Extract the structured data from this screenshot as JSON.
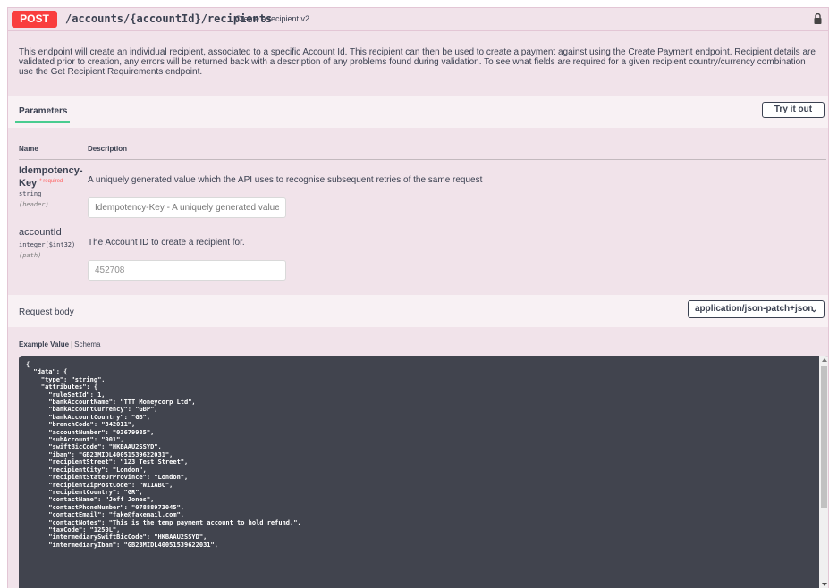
{
  "operation": {
    "method": "POST",
    "path": "/accounts/{accountId}/recipients",
    "summary": "Create a recipient v2",
    "method_color": "#f93e3e"
  },
  "description": "This endpoint will create an individual recipient, associated to a specific Account Id. This recipient can then be used to create a payment against using the Create Payment endpoint. Recipient details are validated prior to creation, any errors will be returned back with a description of any problems found during validation. To see what fields are required for a given recipient country/currency combination use the Get Recipient Requirements endpoint.",
  "parameters": {
    "title": "Parameters",
    "try_label": "Try it out",
    "col_name": "Name",
    "col_description": "Description",
    "items": [
      {
        "name_line1": "Idempotency-",
        "name_line2": "Key",
        "required_marker": "* required",
        "type": "string",
        "in": "(header)",
        "description": "A uniquely generated value which the API uses to recognise subsequent retries of the same request",
        "placeholder": "Idempotency-Key - A uniquely generated value which the API uses to recognise subsequent retries of the same request"
      },
      {
        "name": "accountId",
        "type": "integer($int32)",
        "in": "(path)",
        "description": "The Account ID to create a recipient for.",
        "value": "452708"
      }
    ]
  },
  "request_body": {
    "title": "Request body",
    "content_type": "application/json-patch+json",
    "tab_example": "Example Value",
    "tab_separator": "|",
    "tab_schema": "Schema",
    "example_lines": [
      "{",
      "  \"data\": {",
      "    \"type\": \"string\",",
      "    \"attributes\": {",
      "      \"ruleSetId\": 1,",
      "      \"bankAccountName\": \"TTT Moneycorp Ltd\",",
      "      \"bankAccountCurrency\": \"GBP\",",
      "      \"bankAccountCountry\": \"GB\",",
      "      \"branchCode\": \"342011\",",
      "      \"accountNumber\": \"03679985\",",
      "      \"subAccount\": \"001\",",
      "      \"swiftBicCode\": \"HKBAAU2SSYD\",",
      "      \"iban\": \"GB23MIDL40051539622031\",",
      "      \"recipientStreet\": \"123 Test Street\",",
      "      \"recipientCity\": \"London\",",
      "      \"recipientStateOrProvince\": \"London\",",
      "      \"recipientZipPostCode\": \"W11ABC\",",
      "      \"recipientCountry\": \"GR\",",
      "      \"contactName\": \"Jeff Jones\",",
      "      \"contactPhoneNumber\": \"07888973045\",",
      "      \"contactEmail\": \"fake@fakemail.com\",",
      "      \"contactNotes\": \"This is the temp payment account to hold refund.\",",
      "      \"taxCode\": \"1250L\",",
      "      \"intermediarySwiftBicCode\": \"HKBAAU2SSYD\",",
      "      \"intermediaryIban\": \"GB23MIDL40051539622031\","
    ]
  }
}
